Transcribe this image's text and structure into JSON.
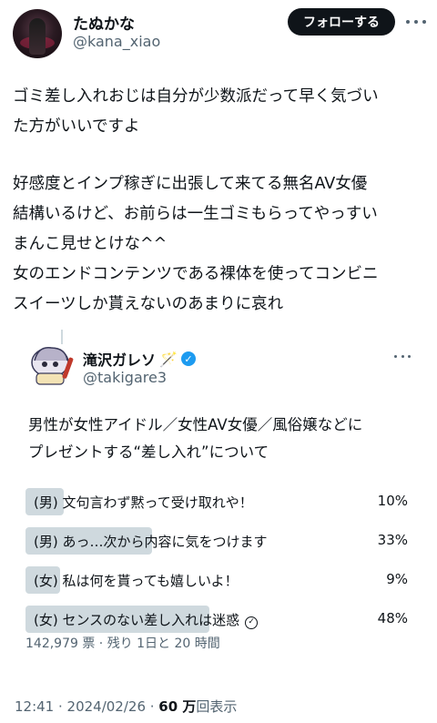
{
  "author": {
    "display_name": "たぬかな",
    "handle": "@kana_xiao",
    "follow_label": "フォローする"
  },
  "tweet": {
    "lines_a": [
      "ゴミ差し入れおじは自分が少数派だって早く気づい",
      "た方がいいですよ"
    ],
    "lines_b": [
      "好感度とインプ稼ぎに出張して来てる無名AV女優",
      "結構いるけど、お前らは一生ゴミもらってやっすい",
      "まんこ見せとけな^^",
      "女のエンドコンテンツである裸体を使ってコンビニ",
      "スイーツしか貰えないのあまりに哀れ"
    ]
  },
  "quote": {
    "display_name": "滝沢ガレソ",
    "handle": "@takigare3",
    "text_lines": [
      "男性が女性アイドル／女性AV女優／風俗嬢などに",
      "プレゼントする“差し入れ”について"
    ],
    "poll": {
      "options": [
        {
          "label": "(男) 文句言わず黙って受け取れや！",
          "percent_text": "10%",
          "percent": 10
        },
        {
          "label": "(男) あっ…次から内容に気をつけます",
          "percent_text": "33%",
          "percent": 33
        },
        {
          "label": "(女) 私は何を貰っても嬉しいよ！",
          "percent_text": "9%",
          "percent": 9
        },
        {
          "label": "(女) センスのない差し入れは迷惑",
          "percent_text": "48%",
          "percent": 48,
          "winner": true
        }
      ],
      "meta": "142,979 票 · 残り 1日と 20 時間"
    }
  },
  "footer": {
    "time": "12:41 · 2024/02/26 · ",
    "views": "60 万",
    "views_suffix": "回表示"
  },
  "colors": {
    "follow_bg": "#0f1419",
    "verified": "#1d9bf0",
    "poll_bar": "#cfd9de",
    "secondary_text": "#536471"
  }
}
